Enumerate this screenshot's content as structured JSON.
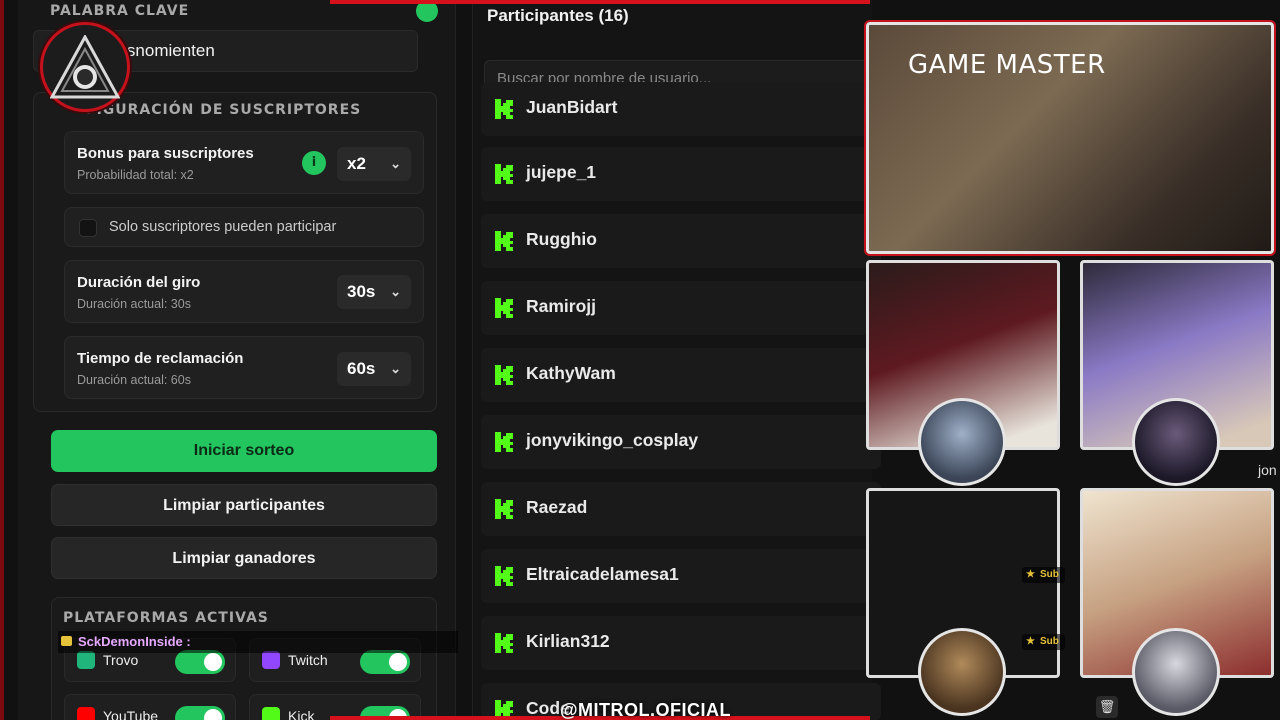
{
  "left": {
    "keyword_label": "PALABRA CLAVE",
    "keyword_value": "dosnomienten",
    "subscriber_config_label": "FIGURACIÓN DE SUSCRIPTORES",
    "bonus": {
      "title": "Bonus para suscriptores",
      "sub": "Probabilidad total: x2",
      "value": "x2",
      "info_glyph": "i"
    },
    "only_subs": "Solo suscriptores pueden participar",
    "spin_duration": {
      "title": "Duración del giro",
      "sub": "Duración actual: 30s",
      "value": "30s"
    },
    "claim_time": {
      "title": "Tiempo de reclamación",
      "sub": "Duración actual: 60s",
      "value": "60s"
    },
    "start_button": "Iniciar sorteo",
    "clear_participants": "Limpiar participantes",
    "clear_winners": "Limpiar ganadores",
    "platforms_label": "PLATAFORMAS ACTIVAS",
    "platforms": [
      {
        "name": "Trovo",
        "enabled": true,
        "color": "#1fb57b"
      },
      {
        "name": "Twitch",
        "enabled": true,
        "color": "#9146ff"
      },
      {
        "name": "YouTube",
        "enabled": true,
        "color": "#ff0000"
      },
      {
        "name": "Kick",
        "enabled": true,
        "color": "#53fc18"
      }
    ]
  },
  "chat_overlay": {
    "user": "SckDemonInside :"
  },
  "participants": {
    "title": "Participantes (16)",
    "search_placeholder": "Buscar por nombre de usuario...",
    "items": [
      "JuanBidart",
      "jujepe_1",
      "Rugghio",
      "Ramirojj",
      "KathyWam",
      "jonyvikingo_cosplay",
      "Raezad",
      "Eltraicadelamesa1",
      "Kirlian312",
      "Code"
    ]
  },
  "cams": {
    "main_label": "GAME MASTER",
    "badges": [
      "Sub",
      "Sub"
    ],
    "side_text": "jon"
  },
  "watermark": "@MITROL.OFICIAL",
  "colors": {
    "accent_green": "#22c55e",
    "kick_green": "#53fc18",
    "frame_red": "#d6111b"
  }
}
